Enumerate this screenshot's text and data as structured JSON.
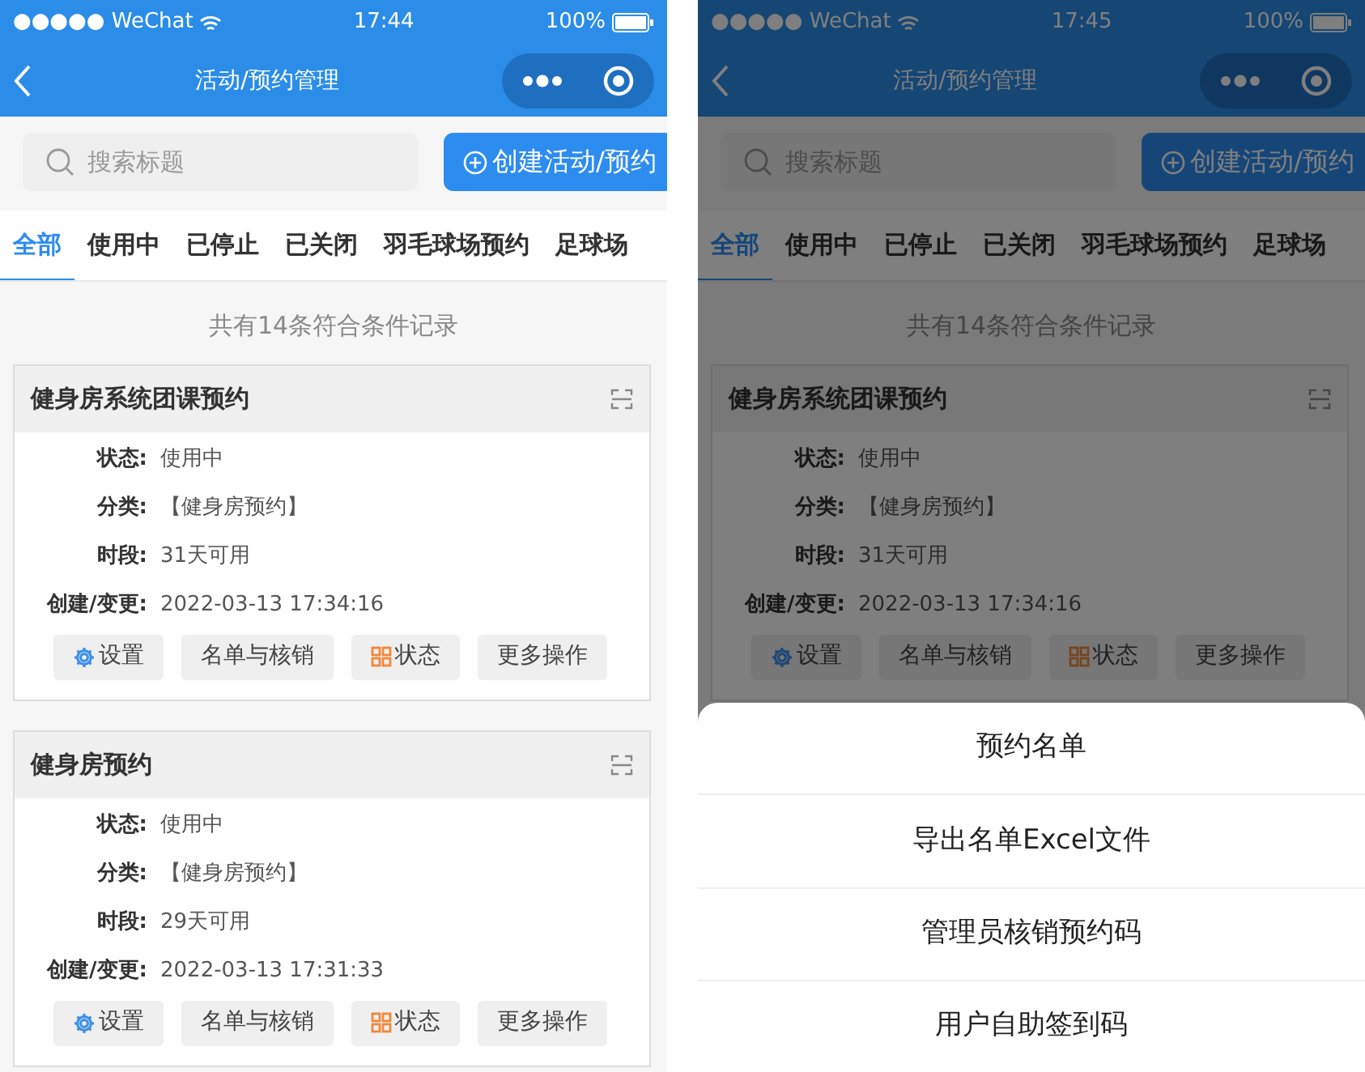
{
  "screens": [
    {
      "status_bar": {
        "carrier": "●●●●● WeChat",
        "time": "17:44",
        "battery": "100%"
      },
      "nav_title": "活动/预约管理",
      "search": {
        "placeholder": "搜索标题"
      },
      "create_button": "创建活动/预约",
      "tabs": [
        {
          "label": "全部",
          "selected": true
        },
        {
          "label": "使用中",
          "selected": false
        },
        {
          "label": "已停止",
          "selected": false
        },
        {
          "label": "已关闭",
          "selected": false
        },
        {
          "label": "羽毛球场预约",
          "selected": false
        },
        {
          "label": "足球场",
          "selected": false
        }
      ],
      "record_count": "共有14条符合条件记录",
      "cards": [
        {
          "title": "健身房系统团课预约",
          "fields": [
            {
              "label": "状态:",
              "value": "使用中"
            },
            {
              "label": "分类:",
              "value": "【健身房预约】"
            },
            {
              "label": "时段:",
              "value": "31天可用"
            },
            {
              "label": "创建/变更:",
              "value": "2022-03-13 17:34:16"
            }
          ],
          "buttons": [
            {
              "label": "设置",
              "kind": "settings"
            },
            {
              "label": "名单与核销",
              "kind": "plain"
            },
            {
              "label": "状态",
              "kind": "status"
            },
            {
              "label": "更多操作",
              "kind": "plain"
            }
          ]
        },
        {
          "title": "健身房预约",
          "fields": [
            {
              "label": "状态:",
              "value": "使用中"
            },
            {
              "label": "分类:",
              "value": "【健身房预约】"
            },
            {
              "label": "时段:",
              "value": "29天可用"
            },
            {
              "label": "创建/变更:",
              "value": "2022-03-13 17:31:33"
            }
          ],
          "buttons": [
            {
              "label": "设置",
              "kind": "settings"
            },
            {
              "label": "名单与核销",
              "kind": "plain"
            },
            {
              "label": "状态",
              "kind": "status"
            },
            {
              "label": "更多操作",
              "kind": "plain"
            }
          ]
        }
      ]
    },
    {
      "status_bar": {
        "carrier": "●●●●● WeChat",
        "time": "17:45",
        "battery": "100%"
      },
      "nav_title": "活动/预约管理",
      "search": {
        "placeholder": "搜索标题"
      },
      "create_button": "创建活动/预约",
      "tabs": [
        {
          "label": "全部",
          "selected": true
        },
        {
          "label": "使用中",
          "selected": false
        },
        {
          "label": "已停止",
          "selected": false
        },
        {
          "label": "已关闭",
          "selected": false
        },
        {
          "label": "羽毛球场预约",
          "selected": false
        },
        {
          "label": "足球场",
          "selected": false
        }
      ],
      "record_count": "共有14条符合条件记录",
      "cards": [
        {
          "title": "健身房系统团课预约",
          "fields": [
            {
              "label": "状态:",
              "value": "使用中"
            },
            {
              "label": "分类:",
              "value": "【健身房预约】"
            },
            {
              "label": "时段:",
              "value": "31天可用"
            },
            {
              "label": "创建/变更:",
              "value": "2022-03-13 17:34:16"
            }
          ],
          "buttons": [
            {
              "label": "设置",
              "kind": "settings"
            },
            {
              "label": "名单与核销",
              "kind": "plain"
            },
            {
              "label": "状态",
              "kind": "status"
            },
            {
              "label": "更多操作",
              "kind": "plain"
            }
          ]
        }
      ],
      "action_sheet": [
        "预约名单",
        "导出名单Excel文件",
        "管理员核销预约码",
        "用户自助签到码"
      ]
    }
  ]
}
